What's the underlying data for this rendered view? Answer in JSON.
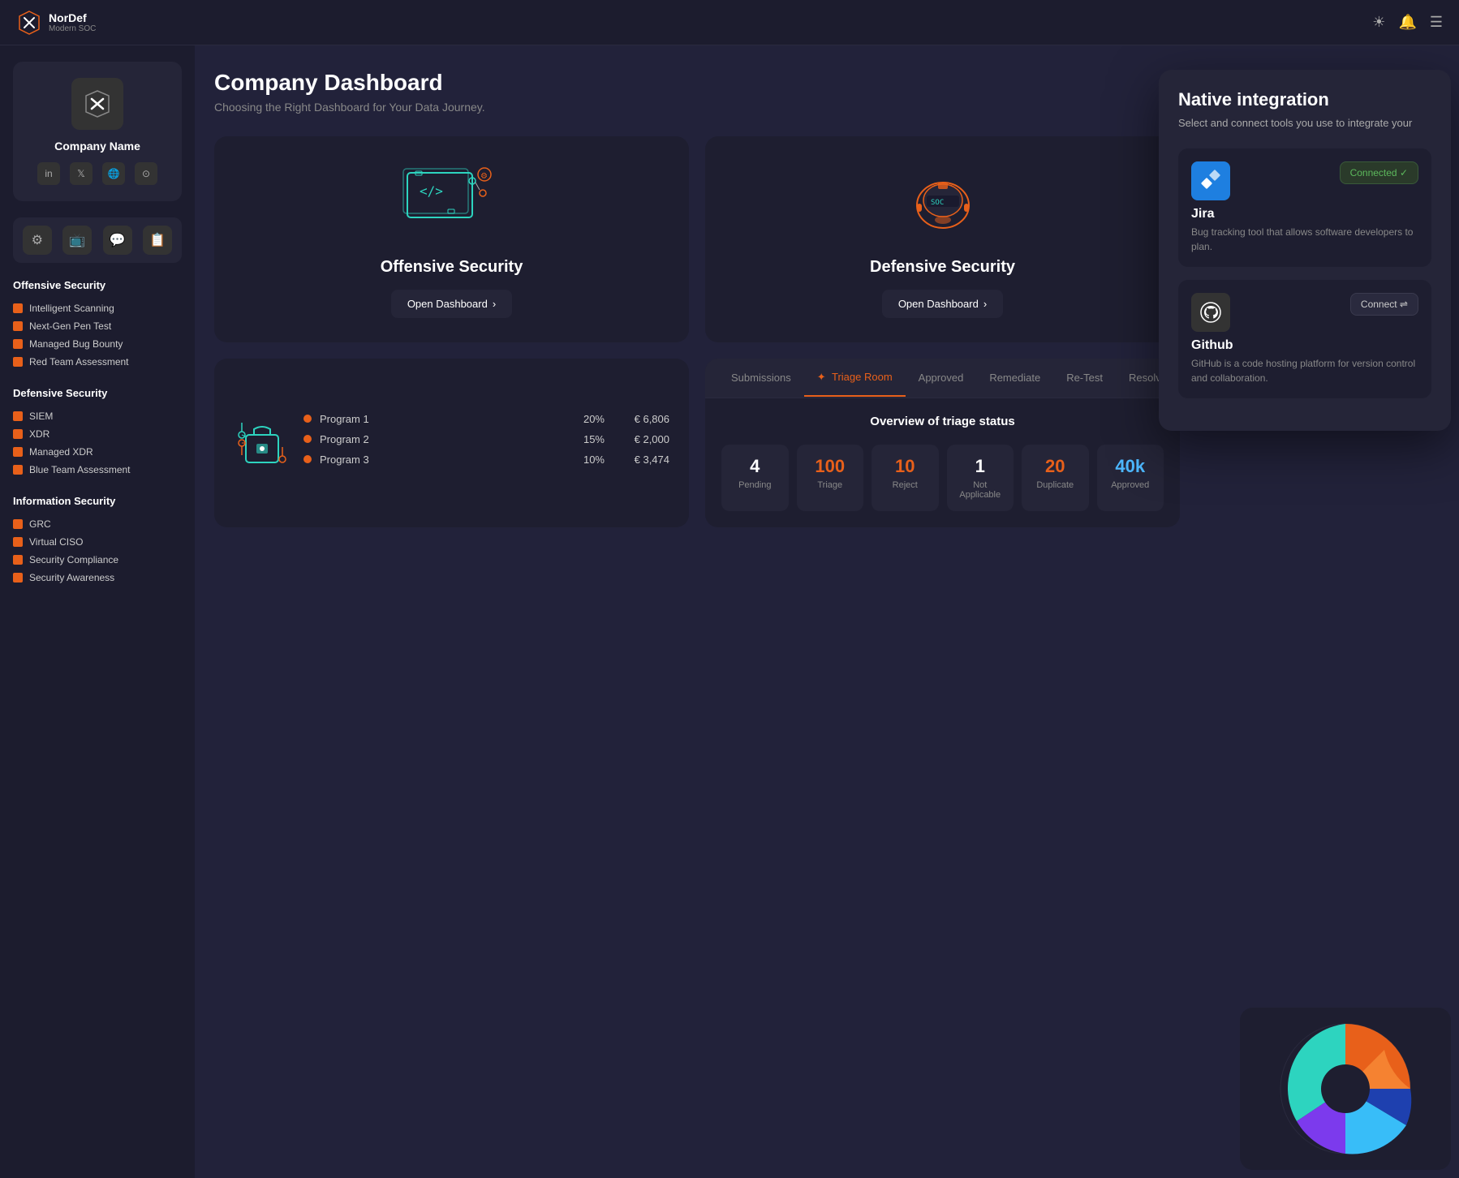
{
  "app": {
    "name": "NorDef",
    "tagline": "Modern SOC"
  },
  "nav": {
    "icons": [
      "☀",
      "🔔",
      "☰"
    ]
  },
  "sidebar": {
    "company": {
      "name": "Company Name",
      "socials": [
        "in",
        "tw",
        "🌐",
        "gh"
      ]
    },
    "tools": [
      "⚙",
      "📺",
      "💬",
      "📋"
    ],
    "sections": [
      {
        "title": "Offensive Security",
        "items": [
          "Intelligent Scanning",
          "Next-Gen Pen Test",
          "Managed Bug Bounty",
          "Red Team Assessment"
        ]
      },
      {
        "title": "Defensive Security",
        "items": [
          "SIEM",
          "XDR",
          "Managed XDR",
          "Blue Team Assessment"
        ]
      },
      {
        "title": "Information Security",
        "items": [
          "GRC",
          "Virtual CISO",
          "Security Compliance",
          "Security Awareness"
        ]
      }
    ]
  },
  "header": {
    "title": "Company Dashboard",
    "subtitle": "Choosing the Right Dashboard for Your Data Journey."
  },
  "dashCards": [
    {
      "title": "Offensive Security",
      "btnLabel": "Open Dashboard",
      "type": "offensive"
    },
    {
      "title": "Defensive Security",
      "btnLabel": "Open Dashboard",
      "type": "defensive"
    }
  ],
  "programs": [
    {
      "name": "Program 1",
      "pct": "20%",
      "amount": "€ 6,806",
      "color": "#e8601a"
    },
    {
      "name": "Program 2",
      "pct": "15%",
      "amount": "€ 2,000",
      "color": "#e8601a"
    },
    {
      "name": "Program 3",
      "pct": "10%",
      "amount": "€ 3,474",
      "color": "#e8601a"
    }
  ],
  "triage": {
    "tabs": [
      "Submissions",
      "Triage Room",
      "Approved",
      "Remediate",
      "Re-Test",
      "Resolved"
    ],
    "activeTab": "Triage Room",
    "overviewTitle": "Overview of triage status",
    "stats": [
      {
        "value": "4",
        "label": "Pending",
        "color": "white"
      },
      {
        "value": "100",
        "label": "Triage",
        "color": "orange"
      },
      {
        "value": "10",
        "label": "Reject",
        "color": "orange"
      },
      {
        "value": "1",
        "label": "Not Applicable",
        "color": "white"
      },
      {
        "value": "20",
        "label": "Duplicate",
        "color": "orange"
      },
      {
        "value": "40k",
        "label": "Approved",
        "color": "blue"
      }
    ]
  },
  "integration": {
    "title": "Native integration",
    "subtitle": "Select and connect tools you use to integrate your",
    "items": [
      {
        "name": "Jira",
        "desc": "Bug tracking tool that allows software developers to plan.",
        "type": "jira",
        "status": "connected",
        "btnLabel": "Connected ✓"
      },
      {
        "name": "Github",
        "desc": "GitHub is a code hosting platform for version control and collaboration.",
        "type": "github",
        "status": "disconnected",
        "btnLabel": "Connect ⇌"
      }
    ]
  }
}
